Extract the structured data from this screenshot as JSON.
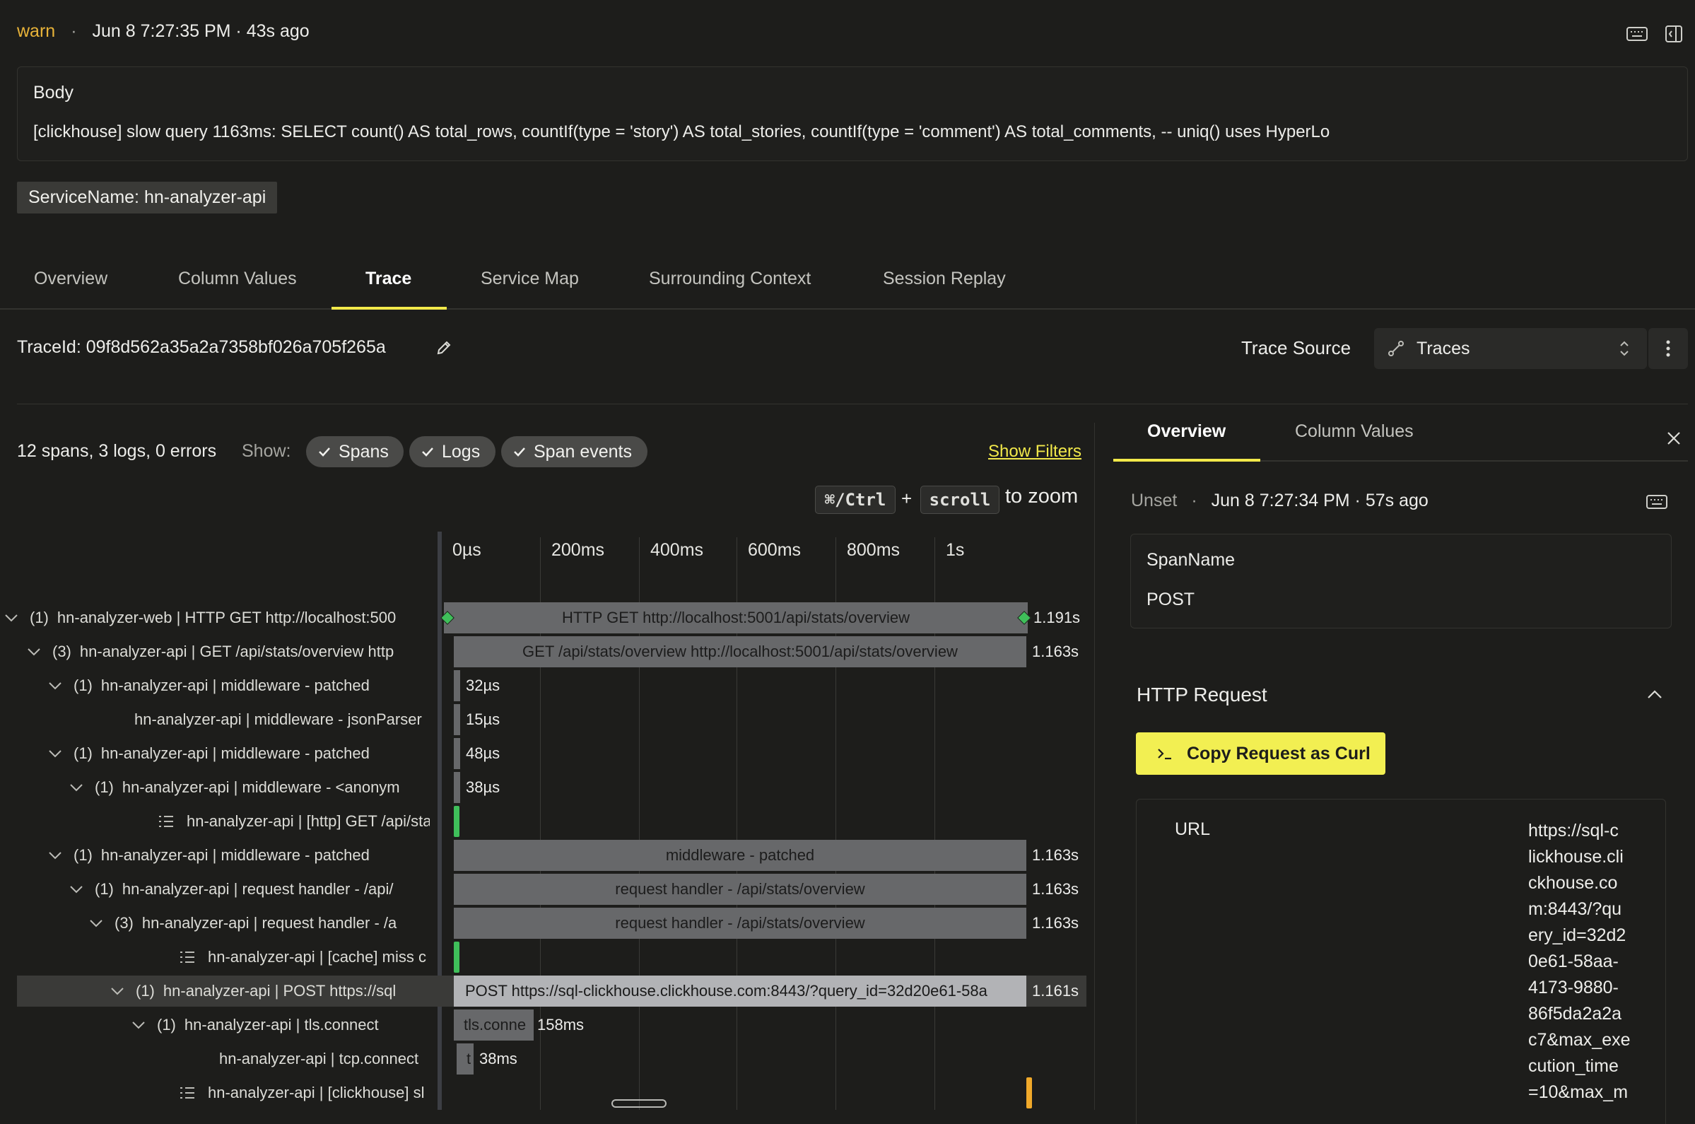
{
  "header": {
    "level": "warn",
    "sep": "·",
    "timestamp": "Jun 8 7:27:35 PM · 43s ago"
  },
  "body_box": {
    "label": "Body",
    "text": "[clickhouse] slow query 1163ms: SELECT count() AS total_rows, countIf(type = 'story') AS total_stories, countIf(type = 'comment') AS total_comments, -- uniq() uses HyperLo"
  },
  "service_chip": "ServiceName: hn-analyzer-api",
  "tabs": [
    "Overview",
    "Column Values",
    "Trace",
    "Service Map",
    "Surrounding Context",
    "Session Replay"
  ],
  "active_tab": "Trace",
  "trace": {
    "trace_id": "TraceId: 09f8d562a35a2a7358bf026a705f265a",
    "source_label": "Trace Source",
    "source_value": "Traces"
  },
  "summary": {
    "counts": "12 spans, 3 logs, 0 errors",
    "show_label": "Show:",
    "filters": [
      "Spans",
      "Logs",
      "Span events"
    ],
    "show_filters": "Show Filters",
    "zoom_key1": "⌘/Ctrl",
    "zoom_plus": "+",
    "zoom_key2": "scroll",
    "zoom_text": "to zoom"
  },
  "timeline_ticks": [
    "0µs",
    "200ms",
    "400ms",
    "600ms",
    "800ms",
    "1s"
  ],
  "rows": [
    {
      "count": "(1)",
      "label": "hn-analyzer-web | HTTP GET http://localhost:500",
      "bar_text": "HTTP GET http://localhost:5001/api/stats/overview",
      "duration": "1.191s"
    },
    {
      "count": "(3)",
      "label": "hn-analyzer-api | GET /api/stats/overview http",
      "bar_text": "GET /api/stats/overview http://localhost:5001/api/stats/overview",
      "duration": "1.163s"
    },
    {
      "count": "(1)",
      "label": "hn-analyzer-api | middleware - patched",
      "bar_text": "",
      "duration": "32µs"
    },
    {
      "count": "",
      "label": "hn-analyzer-api | middleware - jsonParser",
      "bar_text": "",
      "duration": "15µs"
    },
    {
      "count": "(1)",
      "label": "hn-analyzer-api | middleware - patched",
      "bar_text": "",
      "duration": "48µs"
    },
    {
      "count": "(1)",
      "label": "hn-analyzer-api | middleware - <anonym",
      "bar_text": "",
      "duration": "38µs"
    },
    {
      "count": "",
      "label": "hn-analyzer-api | [http] GET /api/sta",
      "bar_text": "",
      "duration": ""
    },
    {
      "count": "(1)",
      "label": "hn-analyzer-api | middleware - patched",
      "bar_text": "middleware - patched",
      "duration": "1.163s"
    },
    {
      "count": "(1)",
      "label": "hn-analyzer-api | request handler - /api/",
      "bar_text": "request handler - /api/stats/overview",
      "duration": "1.163s"
    },
    {
      "count": "(3)",
      "label": "hn-analyzer-api | request handler - /a",
      "bar_text": "request handler - /api/stats/overview",
      "duration": "1.163s"
    },
    {
      "count": "",
      "label": "hn-analyzer-api | [cache] miss c",
      "bar_text": "",
      "duration": ""
    },
    {
      "count": "(1)",
      "label": "hn-analyzer-api | POST https://sql",
      "bar_text": "POST https://sql-clickhouse.clickhouse.com:8443/?query_id=32d20e61-58a",
      "duration": "1.161s"
    },
    {
      "count": "(1)",
      "label": "hn-analyzer-api | tls.connect",
      "bar_text": "tls.conne",
      "duration": "158ms"
    },
    {
      "count": "",
      "label": "hn-analyzer-api | tcp.connect",
      "bar_text": "t",
      "duration": "38ms"
    },
    {
      "count": "",
      "label": "hn-analyzer-api | [clickhouse] sl",
      "bar_text": "",
      "duration": ""
    }
  ],
  "panel": {
    "tabs": [
      "Overview",
      "Column Values"
    ],
    "status": "Unset",
    "sep": "·",
    "timestamp": "Jun 8 7:27:34 PM · 57s ago",
    "span_name_label": "SpanName",
    "span_name_value": "POST",
    "section_title": "HTTP Request",
    "copy_button": "Copy Request as Curl",
    "url_label": "URL",
    "url_lines": [
      "https://sql-c",
      "lickhouse.cli",
      "ckhouse.co",
      "m:8443/?qu",
      "ery_id=32d2",
      "0e61-58aa-",
      "4173-9880-",
      "86f5da2a2a",
      "c7&max_exe",
      "cution_time",
      "=10&max_m"
    ]
  },
  "colors": {
    "accent": "#f2e94a",
    "warn": "#e8b339",
    "bar": "#67686a",
    "bar_selected": "#b2b3b6",
    "log_green": "#3fbf5a",
    "log_orange": "#f0a92a"
  },
  "icons": [
    "keyboard-icon",
    "panel-toggle-icon",
    "pencil-icon",
    "trace-link-icon",
    "updown-chevron-icon",
    "kebab-menu-icon",
    "check-icon",
    "close-icon",
    "chevron-up-icon",
    "terminal-icon",
    "chevron-down-icon",
    "log-list-icon"
  ]
}
